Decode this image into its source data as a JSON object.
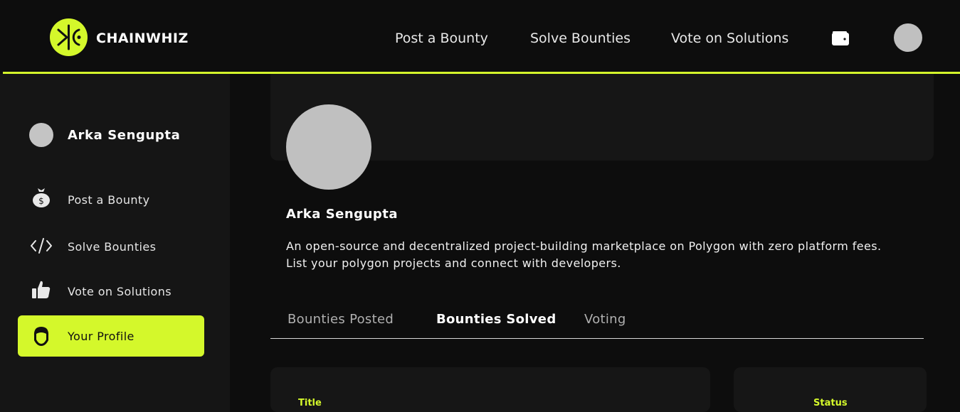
{
  "brand": {
    "name": "CHAINWHIZ",
    "accent": "#d4f82b"
  },
  "nav": {
    "post_bounty": "Post a Bounty",
    "solve_bounties": "Solve Bounties",
    "vote_solutions": "Vote on Solutions"
  },
  "icons": {
    "wallet": "wallet-icon",
    "logo": "chainwhiz-logo-icon"
  },
  "sidebar": {
    "user_name": "Arka Sengupta",
    "items": [
      {
        "label": "Post a Bounty",
        "icon": "money-bag-icon"
      },
      {
        "label": "Solve Bounties",
        "icon": "code-icon"
      },
      {
        "label": "Vote on Solutions",
        "icon": "thumbs-up-icon"
      },
      {
        "label": "Your Profile",
        "icon": "user-face-icon",
        "active": true
      }
    ]
  },
  "profile": {
    "name": "Arka Sengupta",
    "bio_line1": "An open-source and decentralized project-building marketplace on Polygon with zero platform fees.",
    "bio_line2": "List your polygon projects and connect with developers."
  },
  "tabs": [
    {
      "label": "Bounties Posted",
      "active": false
    },
    {
      "label": "Bounties Solved",
      "active": true
    },
    {
      "label": "Voting",
      "active": false
    }
  ],
  "table": {
    "title_header": "Title",
    "status_header": "Status"
  }
}
